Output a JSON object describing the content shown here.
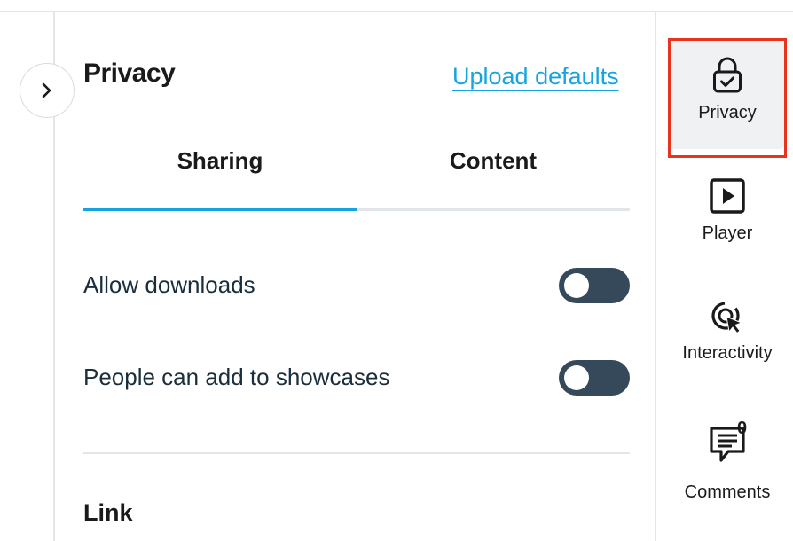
{
  "panel": {
    "title": "Privacy",
    "upload_defaults_link": "Upload defaults"
  },
  "tabs": [
    {
      "label": "Sharing",
      "active": true
    },
    {
      "label": "Content",
      "active": false
    }
  ],
  "settings": [
    {
      "label": "Allow downloads",
      "enabled": false
    },
    {
      "label": "People can add to showcases",
      "enabled": false
    }
  ],
  "section": {
    "title": "Link"
  },
  "sidebar": {
    "items": [
      {
        "label": "Privacy",
        "icon": "lock-icon",
        "active": true
      },
      {
        "label": "Player",
        "icon": "play-icon",
        "active": false
      },
      {
        "label": "Interactivity",
        "icon": "cursor-click-icon",
        "active": false
      },
      {
        "label": "Comments",
        "icon": "comment-icon",
        "active": false,
        "badge": "0"
      }
    ]
  },
  "colors": {
    "accent": "#17a3e0",
    "toggle_off": "#35495a",
    "highlight_outline": "#e8341c"
  }
}
